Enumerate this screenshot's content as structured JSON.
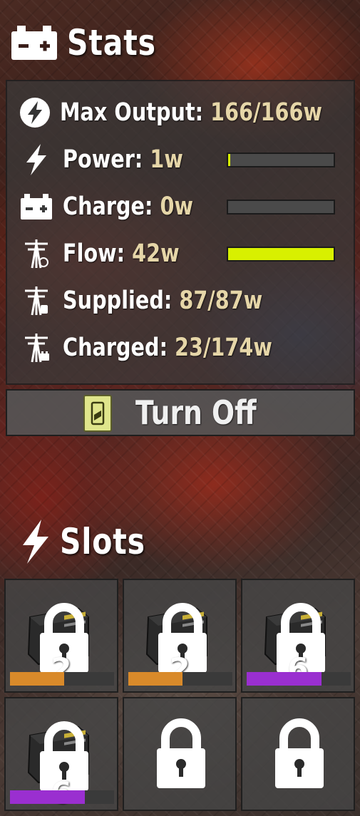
{
  "stats": {
    "title": "Stats",
    "rows": [
      {
        "label": "Max Output: ",
        "value": "166/166w",
        "icon": "power-circle-icon"
      },
      {
        "label": "Power: ",
        "value": "1w",
        "icon": "lightning-icon",
        "bar": 0.02
      },
      {
        "label": "Charge: ",
        "value": "0w",
        "icon": "battery-icon",
        "bar": 0.0
      },
      {
        "label": "Flow: ",
        "value": "42w",
        "icon": "pylon-flow-icon",
        "bar": 1.0
      },
      {
        "label": "Supplied: ",
        "value": "87/87w",
        "icon": "pylon-supplied-icon"
      },
      {
        "label": "Charged: ",
        "value": "23/174w",
        "icon": "pylon-charged-icon"
      }
    ],
    "bar_color": "#d8f000"
  },
  "toggle": {
    "label": "Turn Off"
  },
  "slots": {
    "title": "Slots",
    "items": [
      {
        "count": "2",
        "battery": true,
        "durability": 0.52,
        "color": "#d98a2a"
      },
      {
        "count": "2",
        "battery": true,
        "durability": 0.52,
        "color": "#d98a2a"
      },
      {
        "count": "6",
        "battery": true,
        "durability": 0.72,
        "color": "#9a2fd0"
      },
      {
        "count": "6",
        "battery": true,
        "durability": 0.72,
        "color": "#9a2fd0"
      },
      {
        "count": "",
        "battery": false
      },
      {
        "count": "",
        "battery": false
      }
    ]
  }
}
